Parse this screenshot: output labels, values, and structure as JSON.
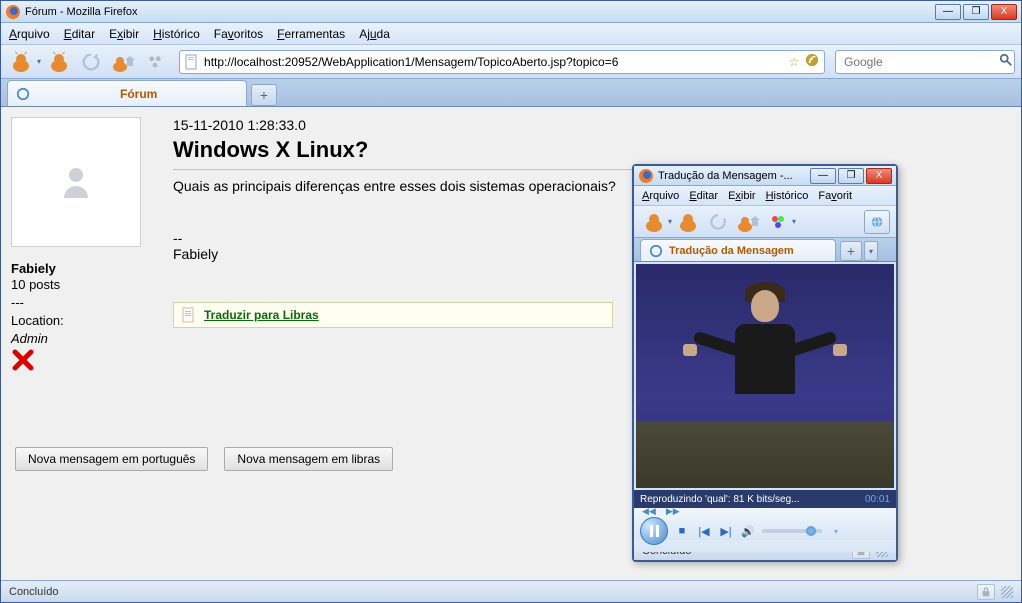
{
  "window": {
    "title": "Fórum - Mozilla Firefox",
    "controls": {
      "min": "—",
      "max": "❐",
      "close": "X"
    }
  },
  "menu": {
    "arquivo": "Arquivo",
    "editar": "Editar",
    "exibir": "Exibir",
    "historico": "Histórico",
    "favoritos": "Favoritos",
    "ferramentas": "Ferramentas",
    "ajuda": "Ajuda"
  },
  "address": {
    "url": "http://localhost:20952/WebApplication1/Mensagem/TopicoAberto.jsp?topico=6"
  },
  "search": {
    "placeholder": "Google"
  },
  "tab": {
    "label": "Fórum",
    "add": "+"
  },
  "post": {
    "date": "15-11-2010 1:28:33.0",
    "title": "Windows X Linux?",
    "body": "Quais as principais diferenças entre esses dois sistemas operacionais?",
    "sig_dash": "--",
    "sig_name": "Fabiely",
    "translate": "Traduzir para Libras"
  },
  "user": {
    "name": "Fabiely",
    "posts": "10 posts",
    "dash": "---",
    "location": "Location:",
    "role": "Admin"
  },
  "actions": {
    "new_pt": "Nova mensagem em português",
    "new_libras": "Nova mensagem em libras"
  },
  "status": {
    "text": "Concluído"
  },
  "popup": {
    "title": "Tradução da Mensagem -...",
    "menu": {
      "arquivo": "Arquivo",
      "editar": "Editar",
      "exibir": "Exibir",
      "historico": "Histórico",
      "favoritos": "Favorit"
    },
    "tab": {
      "label": "Tradução da Mensagem",
      "add": "+"
    },
    "playback": {
      "status": "Reproduzindo 'qual': 81 K bits/seg...",
      "time": "00:01"
    },
    "status": "Concluído"
  }
}
